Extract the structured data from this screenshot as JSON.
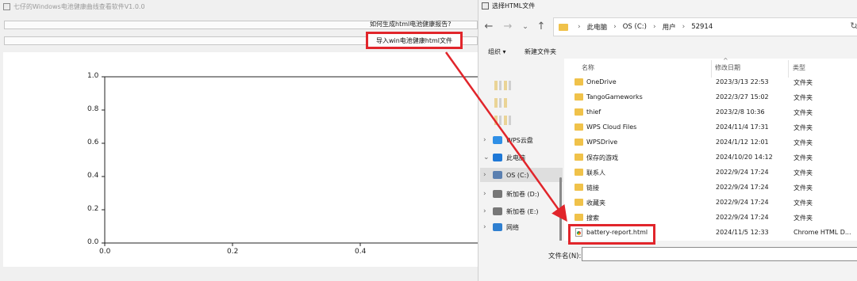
{
  "app": {
    "title": "七仔的Windows电池健康曲线查看软件V1.0.0",
    "help_link": "如何生成html电池健康报告?",
    "import_button": "导入win电池健康html文件",
    "plot": {
      "x_ticks": [
        "0.0",
        "0.2",
        "0.4"
      ],
      "y_ticks": [
        "1.0",
        "0.8",
        "0.6",
        "0.4",
        "0.2",
        "0.0"
      ]
    }
  },
  "dialog": {
    "title": "选择HTML文件",
    "breadcrumb": [
      "此电脑",
      "OS (C:)",
      "用户",
      "52914"
    ],
    "toolbar": {
      "organize": "组织 ▾",
      "new_folder": "新建文件夹"
    },
    "columns": {
      "name": "名称",
      "modified": "修改日期",
      "type": "类型"
    },
    "nav_items": [
      {
        "label": "WPS云盘",
        "icon": "cloud-icon",
        "color": "#2f8fe6",
        "chev": ">"
      },
      {
        "label": "此电脑",
        "icon": "pc-icon",
        "color": "#1e78d7",
        "chev": "v"
      },
      {
        "label": "OS (C:)",
        "icon": "drive-icon",
        "color": "#5a7fb0",
        "chev": ">"
      },
      {
        "label": "新加卷 (D:)",
        "icon": "drive-icon",
        "color": "#777777",
        "chev": ">"
      },
      {
        "label": "新加卷 (E:)",
        "icon": "drive-icon",
        "color": "#777777",
        "chev": ">"
      },
      {
        "label": "网络",
        "icon": "network-icon",
        "color": "#2f7fd0",
        "chev": ">"
      }
    ],
    "files": [
      {
        "name": "OneDrive",
        "date": "2023/3/13 22:53",
        "type": "文件夹",
        "kind": "folder"
      },
      {
        "name": "TangoGameworks",
        "date": "2022/3/27 15:02",
        "type": "文件夹",
        "kind": "folder"
      },
      {
        "name": "thief",
        "date": "2023/2/8 10:36",
        "type": "文件夹",
        "kind": "folder"
      },
      {
        "name": "WPS Cloud Files",
        "date": "2024/11/4 17:31",
        "type": "文件夹",
        "kind": "folder"
      },
      {
        "name": "WPSDrive",
        "date": "2024/1/12 12:01",
        "type": "文件夹",
        "kind": "folder"
      },
      {
        "name": "保存的游戏",
        "date": "2024/10/20 14:12",
        "type": "文件夹",
        "kind": "folder"
      },
      {
        "name": "联系人",
        "date": "2022/9/24 17:24",
        "type": "文件夹",
        "kind": "folder"
      },
      {
        "name": "链接",
        "date": "2022/9/24 17:24",
        "type": "文件夹",
        "kind": "folder"
      },
      {
        "name": "收藏夹",
        "date": "2022/9/24 17:24",
        "type": "文件夹",
        "kind": "folder"
      },
      {
        "name": "搜索",
        "date": "2022/9/24 17:24",
        "type": "文件夹",
        "kind": "folder"
      },
      {
        "name": "battery-report.html",
        "date": "2024/11/5 12:33",
        "type": "Chrome HTML D...",
        "kind": "html"
      }
    ],
    "filename_label": "文件名(N):",
    "filename_value": ""
  },
  "colors": {
    "highlight": "#e1252b",
    "folder": "#f0c24a"
  }
}
